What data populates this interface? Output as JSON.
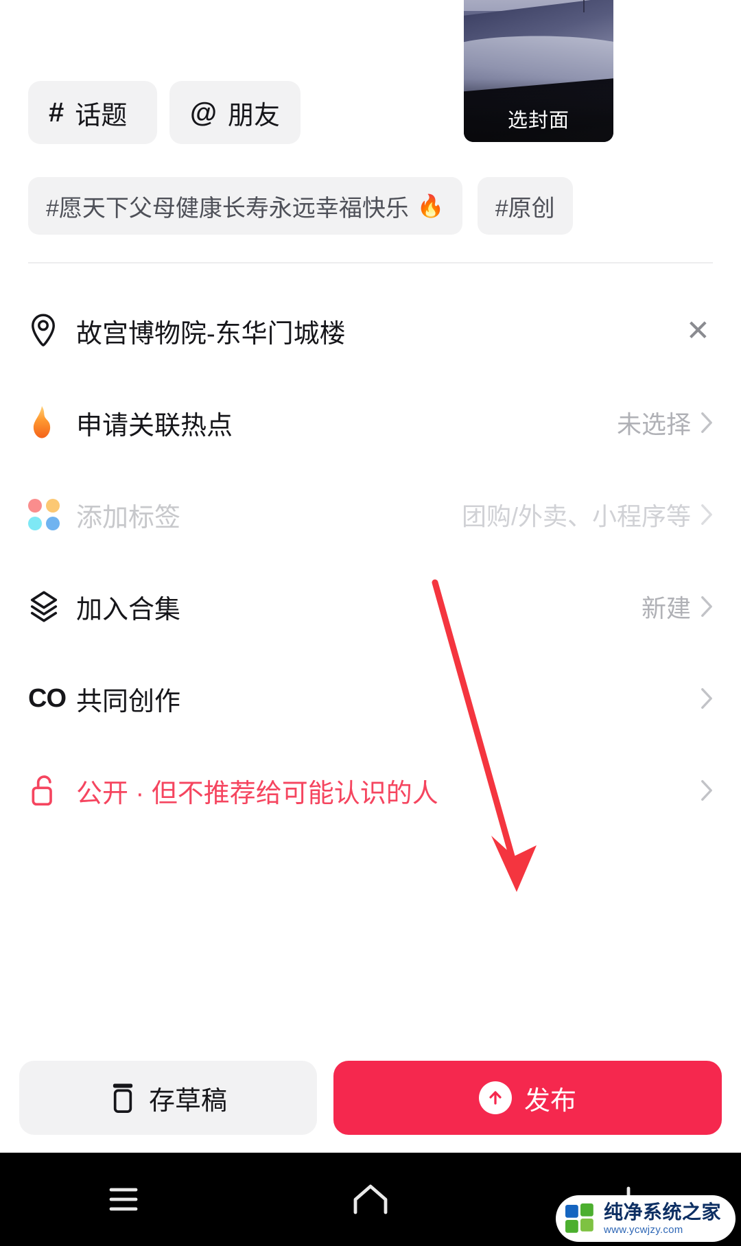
{
  "cover": {
    "label": "选封面"
  },
  "quick_actions": [
    {
      "symbol": "#",
      "label": "话题",
      "icon": "hash-icon"
    },
    {
      "symbol": "@",
      "label": "朋友",
      "icon": "at-icon"
    }
  ],
  "tag_suggestions": [
    {
      "text": "#愿天下父母健康长寿永远幸福快乐",
      "flame": "🔥",
      "hot": true
    },
    {
      "text": "#原创",
      "flame": "",
      "hot": false
    }
  ],
  "options": [
    {
      "icon": "location-pin-icon",
      "label": "故宫博物院-东华门城楼",
      "value": "",
      "trailing": "close-icon",
      "close_glyph": "✕",
      "style": "normal"
    },
    {
      "icon": "flame-icon",
      "label": "申请关联热点",
      "value": "未选择",
      "trailing": "chevron-right-icon",
      "style": "normal"
    },
    {
      "icon": "color-dots-icon",
      "label": "添加标签",
      "value": "团购/外卖、小程序等",
      "trailing": "chevron-right-icon",
      "style": "disabled"
    },
    {
      "icon": "layers-icon",
      "label": "加入合集",
      "value": "新建",
      "trailing": "chevron-right-icon",
      "style": "normal"
    },
    {
      "icon": "co-creation-icon",
      "icon_text": "CO",
      "label": "共同创作",
      "value": "",
      "trailing": "chevron-right-icon",
      "style": "normal"
    },
    {
      "icon": "unlock-icon",
      "label": "公开 · 但不推荐给可能认识的人",
      "value": "",
      "trailing": "chevron-right-icon",
      "style": "accent"
    }
  ],
  "actions": {
    "draft_label": "存草稿",
    "draft_icon": "draft-box-icon",
    "publish_label": "发布",
    "publish_icon": "arrow-up-circle-icon"
  },
  "navbar": {
    "recents_icon": "recents-icon",
    "home_icon": "home-icon",
    "back_icon": "back-icon"
  },
  "watermark": {
    "title": "纯净系统之家",
    "url": "www.ycwjzy.com"
  },
  "colors": {
    "accent_red": "#f5455f",
    "publish_red": "#f5284e",
    "chip_bg": "#f2f2f3",
    "text_primary": "#16161a",
    "text_muted": "#b0b1b6",
    "annotation_red": "#f4353f"
  }
}
